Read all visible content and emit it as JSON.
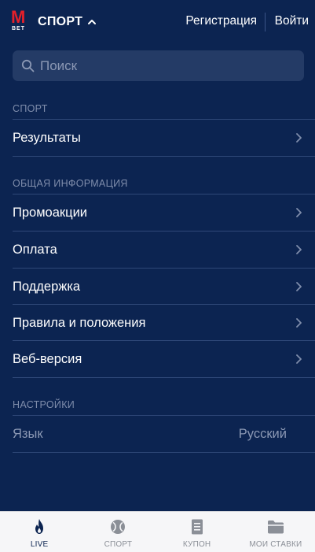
{
  "colors": {
    "background": "#0c2451",
    "search_bg": "#243b66",
    "logo_red": "#e4202a",
    "muted_text": "#7f8dab",
    "divider": "#2f4878",
    "tabbar_bg": "#f6f6f8",
    "tab_active": "#0c2451",
    "tab_inactive": "#8b8f97"
  },
  "header": {
    "logo_letter": "M",
    "logo_sub": "BET",
    "sport_label": "СПОРТ",
    "sport_icon": "chevron-up-icon",
    "register_label": "Регистрация",
    "login_label": "Войти"
  },
  "search": {
    "placeholder": "Поиск",
    "value": "",
    "icon": "search-icon"
  },
  "sections": {
    "sport": {
      "title": "СПОРТ",
      "items": [
        {
          "label": "Результаты",
          "icon": "chevron-right-icon"
        }
      ]
    },
    "info": {
      "title": "ОБЩАЯ ИНФОРМАЦИЯ",
      "items": [
        {
          "label": "Промоакции",
          "icon": "chevron-right-icon"
        },
        {
          "label": "Оплата",
          "icon": "chevron-right-icon"
        },
        {
          "label": "Поддержка",
          "icon": "chevron-right-icon"
        },
        {
          "label": "Правила и положения",
          "icon": "chevron-right-icon"
        },
        {
          "label": "Веб-версия",
          "icon": "chevron-right-icon"
        }
      ]
    },
    "settings": {
      "title": "НАСТРОЙКИ",
      "language_label": "Язык",
      "language_value": "Русский"
    }
  },
  "tabbar": {
    "tabs": [
      {
        "label": "LIVE",
        "icon": "flame-icon",
        "active": true
      },
      {
        "label": "СПОРТ",
        "icon": "ball-icon",
        "active": false
      },
      {
        "label": "КУПОН",
        "icon": "coupon-icon",
        "active": false
      },
      {
        "label": "МОИ СТАВКИ",
        "icon": "folder-icon",
        "active": false
      }
    ]
  }
}
